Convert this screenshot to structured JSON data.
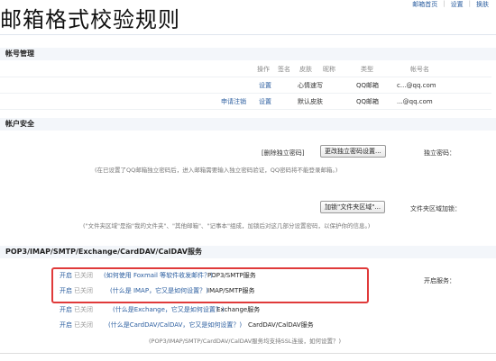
{
  "headline": "邮箱格式校验规则",
  "topbar": {
    "home": "邮箱首页",
    "settings": "设置",
    "switch": "换肤"
  },
  "accounts": {
    "title": "帐号管理",
    "headers": [
      "帐号名",
      "类型",
      "昵称",
      "皮肤",
      "签名",
      "操作"
    ],
    "rows": [
      {
        "name": "c...@qq.com",
        "type": "QQ邮箱",
        "nick": "心情速写",
        "skin": "",
        "sign": "",
        "ops": [
          "设置"
        ]
      },
      {
        "name": "...@qq.com",
        "type": "QQ邮箱",
        "nick": "默认皮肤",
        "skin": "",
        "sign": "",
        "ops": [
          "设置",
          "申请注销"
        ]
      }
    ]
  },
  "security": {
    "title": "帐户安全",
    "pwd_label": "独立密码：",
    "pwd_btn": "更改独立密码设置...",
    "pwd_link": "[删除独立密码]",
    "pwd_note": "(在已设置了QQ邮箱独立密码后，进入邮箱需要输入独立密码验证，QQ密码将不能登录邮箱。)",
    "folder_label": "文件夹区域加锁：",
    "folder_btn": "加锁\"文件夹区域\"...",
    "folder_note": "(\"文件夹区域\"是指\"我的文件夹\"、\"其他邮箱\"、\"记事本\"组成，加锁后对这几部分设置密码，以保护你的信息。)"
  },
  "services": {
    "title": "POP3/IMAP/SMTP/Exchange/CardDAV/CalDAV服务",
    "open_label": "开启服务：",
    "rows": [
      {
        "name": "POP3/SMTP服务",
        "link": "(如何使用 Foxmail 等软件收发邮件？)",
        "status": "已关闭",
        "sw": "开启"
      },
      {
        "name": "IMAP/SMTP服务",
        "link": "(什么是 IMAP，它又是如何设置？)",
        "status": "已关闭",
        "sw": "开启"
      },
      {
        "name": "Exchange服务",
        "link": "(什么是Exchange，它又是如何设置？)",
        "status": "已关闭",
        "sw": "开启"
      },
      {
        "name": "CardDAV/CalDAV服务",
        "link": "(什么是CardDAV/CalDAV，它又是如何设置？)",
        "status": "已关闭",
        "sw": "开启"
      }
    ],
    "note": "(POP3/IMAP/SMTP/CardDAV/CalDAV服务均支持SSL连接，如何设置？)"
  }
}
